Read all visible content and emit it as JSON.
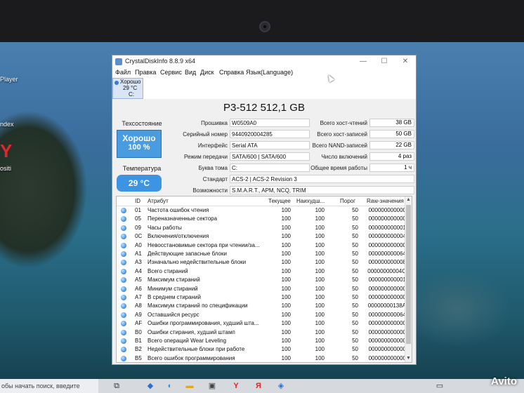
{
  "desktop": {
    "labels": [
      "Player",
      "ndex",
      "ositi"
    ]
  },
  "taskbar": {
    "search_placeholder": "обы начать поиск, введите"
  },
  "watermark": "Avito",
  "window": {
    "title": "CrystalDiskInfo 8.8.9 x64",
    "menu": [
      "Файл",
      "Правка",
      "Сервис",
      "Вид",
      "Диск",
      "Справка",
      "Язык(Language)"
    ],
    "disk_tab": {
      "status": "Хорошо",
      "temp": "29 °C",
      "drive": "C:"
    },
    "model": "P3-512 512,1 GB",
    "health": {
      "label": "Техсостояние",
      "status": "Хорошо",
      "percent": "100 %",
      "color": "#4a9ce0"
    },
    "temperature": {
      "label": "Температура",
      "value": "29 °C",
      "color": "#3c94e3"
    },
    "info": [
      {
        "label": "Прошивка",
        "value": "W0509A0"
      },
      {
        "label": "Серийный номер",
        "value": "9440920004285"
      },
      {
        "label": "Интерфейс",
        "value": "Serial ATA"
      },
      {
        "label": "Режим передачи",
        "value": "SATA/600 | SATA/600"
      },
      {
        "label": "Буква тома",
        "value": "C:"
      },
      {
        "label": "Стандарт",
        "value": "ACS-2 | ACS-2 Revision 3"
      },
      {
        "label": "Возможности",
        "value": "S.M.A.R.T., APM, NCQ, TRIM"
      }
    ],
    "stats": [
      {
        "label": "Всего хост-чтений",
        "value": "38 GB"
      },
      {
        "label": "Всего хост-записей",
        "value": "50 GB"
      },
      {
        "label": "Всего NAND-записей",
        "value": "22 GB"
      },
      {
        "label": "Число включений",
        "value": "4 раз"
      },
      {
        "label": "Общее время работы",
        "value": "1 ч"
      }
    ],
    "table": {
      "headers": [
        "ID",
        "Атрибут",
        "Текущее",
        "Наихудш...",
        "Порог",
        "Raw-значения"
      ],
      "rows": [
        [
          "01",
          "Частота ошибок чтения",
          "100",
          "100",
          "50",
          "000000000000"
        ],
        [
          "05",
          "Переназначенные сектора",
          "100",
          "100",
          "50",
          "000000000000"
        ],
        [
          "09",
          "Часы работы",
          "100",
          "100",
          "50",
          "000000000001"
        ],
        [
          "0C",
          "Включения/отключения",
          "100",
          "100",
          "50",
          "000000000004"
        ],
        [
          "A0",
          "Невосстановимые сектора при чтении/за...",
          "100",
          "100",
          "50",
          "000000000000"
        ],
        [
          "A1",
          "Действующие запасные блоки",
          "100",
          "100",
          "50",
          "000000000064"
        ],
        [
          "A3",
          "Изначально недействительные блоки",
          "100",
          "100",
          "50",
          "000000000008"
        ],
        [
          "A4",
          "Всего стираний",
          "100",
          "100",
          "50",
          "00000000004C"
        ],
        [
          "A5",
          "Максимум стираний",
          "100",
          "100",
          "50",
          "000000000001"
        ],
        [
          "A6",
          "Минимум стираний",
          "100",
          "100",
          "50",
          "000000000000"
        ],
        [
          "A7",
          "В среднем стираний",
          "100",
          "100",
          "50",
          "000000000000"
        ],
        [
          "A8",
          "Максимум стираний по спецификации",
          "100",
          "100",
          "50",
          "00000000138A"
        ],
        [
          "A9",
          "Оставшийся ресурс",
          "100",
          "100",
          "50",
          "000000000064"
        ],
        [
          "AF",
          "Ошибки программирования, худший шта...",
          "100",
          "100",
          "50",
          "000000000000"
        ],
        [
          "B0",
          "Ошибки стирания, худший штамп",
          "100",
          "100",
          "50",
          "000000000000"
        ],
        [
          "B1",
          "Всего операций Wear Leveling",
          "100",
          "100",
          "50",
          "000000000000"
        ],
        [
          "B2",
          "Недействительные блоки при работе",
          "100",
          "100",
          "50",
          "000000000000"
        ],
        [
          "B5",
          "Всего ошибок программирования",
          "100",
          "100",
          "50",
          "000000000000"
        ]
      ]
    }
  }
}
